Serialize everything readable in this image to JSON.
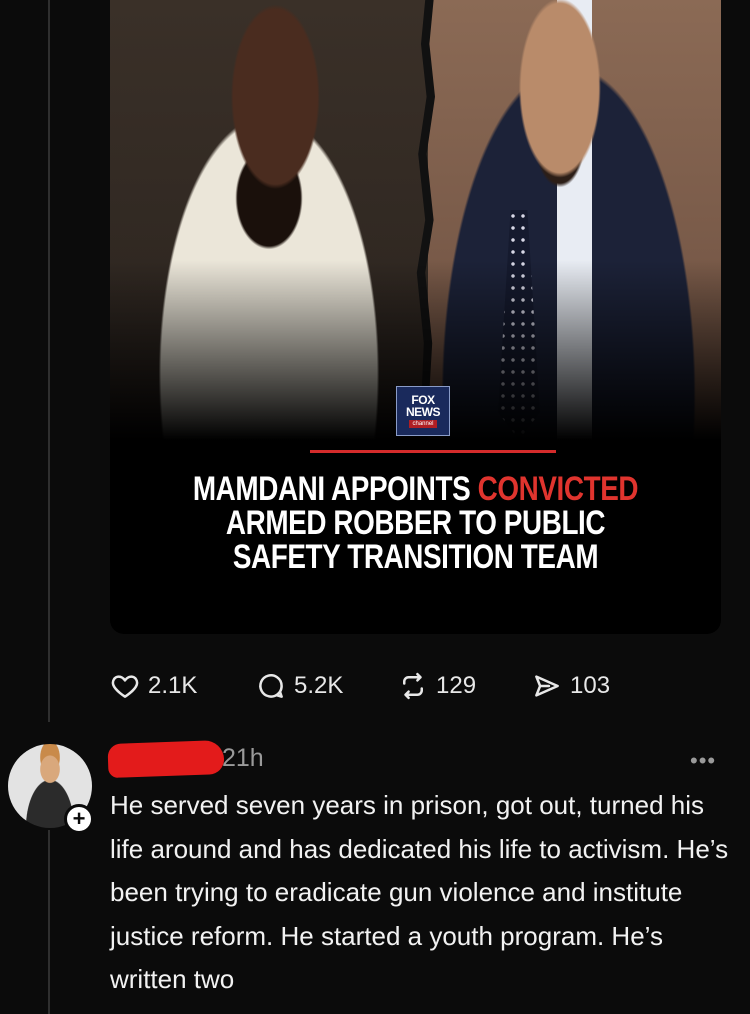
{
  "post": {
    "media": {
      "logo": {
        "line1": "FOX",
        "line2": "NEWS",
        "line3": "channel"
      },
      "headline": {
        "part1": "MAMDANI APPOINTS ",
        "highlight": "CONVICTED",
        "part2": " ARMED ROBBER TO PUBLIC SAFETY TRANSITION TEAM"
      },
      "colors": {
        "highlight": "#e0342e",
        "rule": "#d42b2b"
      }
    },
    "actions": [
      {
        "icon": "heart-icon",
        "count": "2.1K"
      },
      {
        "icon": "comment-icon",
        "count": "5.2K"
      },
      {
        "icon": "repost-icon",
        "count": "129"
      },
      {
        "icon": "share-icon",
        "count": "103"
      }
    ]
  },
  "reply": {
    "timestamp": "21h",
    "more": "•••",
    "plus": "+",
    "text": "He served seven years in prison, got out, turned his life around and has dedicated his life to activism. He’s been trying to eradicate gun violence and institute justice reform. He started a youth program. He’s written two"
  }
}
